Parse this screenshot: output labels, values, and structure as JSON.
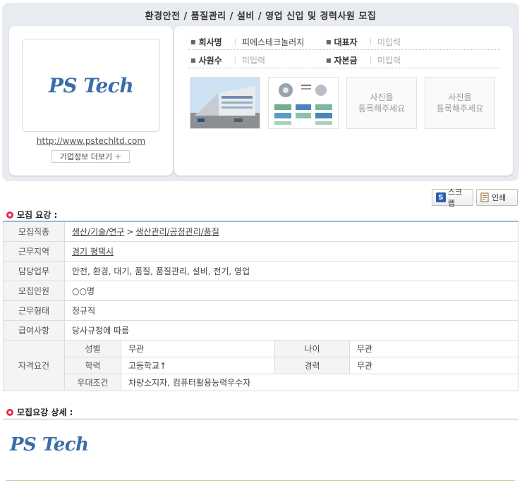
{
  "header": {
    "title": "환경안전 / 품질관리 / 설비 / 영업 신입 및 경력사원 모집"
  },
  "company": {
    "logo_text": "PS Tech",
    "homepage": "http://www.pstechltd.com",
    "more_button": "기업정보 더보기",
    "more_icon": "+",
    "info": [
      {
        "label": "회사명",
        "value": "피에스테크놀러지",
        "missing": false
      },
      {
        "label": "대표자",
        "value": "미입력",
        "missing": true
      },
      {
        "label": "사원수",
        "value": "미입력",
        "missing": true
      },
      {
        "label": "자본금",
        "value": "미입력",
        "missing": true
      }
    ],
    "photos": [
      {
        "type": "building-photo"
      },
      {
        "type": "product-diagram"
      },
      {
        "type": "empty",
        "text": "사진을\n등록해주세요"
      },
      {
        "type": "empty",
        "text": "사진을\n등록해주세요"
      }
    ]
  },
  "actions": {
    "scrap": "스크랩",
    "print": "인쇄"
  },
  "section1": {
    "title": "모집 요강 :"
  },
  "requirements": {
    "job_type_label": "모집직종",
    "job_type_links": [
      "생산/기술/연구",
      "생산관리/공정관리/품질"
    ],
    "job_type_arrow": ">",
    "location_label": "근무지역",
    "location": "경기 평택시",
    "duties_label": "담당업무",
    "duties": "안전, 환경, 대기, 품질, 품질관리, 설비, 전기, 영업",
    "headcount_label": "모집인원",
    "headcount": "○○명",
    "employment_label": "근무형태",
    "employment": "정규직",
    "salary_label": "급여사항",
    "salary": "당사규정에 따름",
    "qualification_label": "자격요건",
    "gender_label": "성별",
    "gender": "무관",
    "age_label": "나이",
    "age": "무관",
    "education_label": "학력",
    "education": "고등학교↑",
    "experience_label": "경력",
    "experience": "무관",
    "preference_label": "우대조건",
    "preference": "차량소지자, 컴퓨터활용능력우수자"
  },
  "section2": {
    "title": "모집요강 상세 :",
    "logo_text": "PS Tech"
  },
  "colors": {
    "accent_red": "#e0314b",
    "logo_blue": "#3a6ea8",
    "table_border": "#9db8cf"
  }
}
